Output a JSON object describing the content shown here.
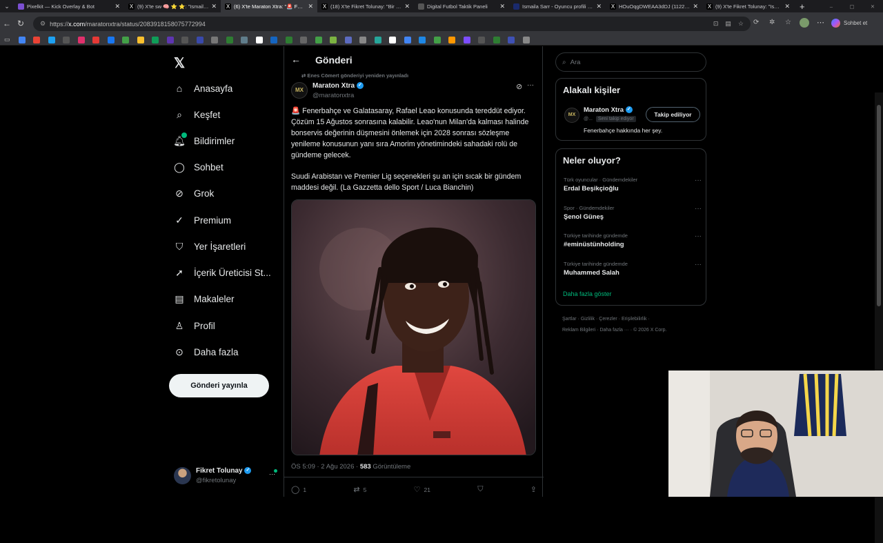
{
  "browser": {
    "tabs": [
      {
        "title": "Pixelkit — Kick Overlay & Bot",
        "color": "#7b4fd1",
        "glyph": "",
        "w": 160
      },
      {
        "title": "(9) X'te sw 🧠 ⭐ ⭐: \"Ismaila Sa",
        "color": "#000000",
        "glyph": "X",
        "w": 140
      },
      {
        "title": "(6) X'te Maraton Xtra: \"🚨 Fene",
        "color": "#000000",
        "glyph": "X",
        "w": 140,
        "active": true
      },
      {
        "title": "(18) X'te Fikret Tolunay: \"Bir sürü",
        "color": "#000000",
        "glyph": "X",
        "w": 140
      },
      {
        "title": "Digital Futbol Taktik Paneli",
        "color": "#555555",
        "glyph": "",
        "w": 138
      },
      {
        "title": "Ismaila Sarr - Oyuncu profili 26/",
        "color": "#1a2a6c",
        "glyph": "",
        "w": 140
      },
      {
        "title": "HOuOqgDWEAA3dDJ (1122×14",
        "color": "#000000",
        "glyph": "X",
        "w": 140
      },
      {
        "title": "(9) X'te Fikret Tolunay: \"Ismaila",
        "color": "#000000",
        "glyph": "X",
        "w": 133
      }
    ],
    "url_prefix": "https://",
    "url_host": "x.com",
    "url_path": "/maratonxtra/status/2083918158075772994",
    "sohbet_label": "Sohbet et",
    "bookmark_colors": [
      "#4285f4",
      "#ea4335",
      "#1da1f2",
      "#555",
      "#e1306c",
      "#e53935",
      "#1877f2",
      "#43a047",
      "#fbc02d",
      "#0f9d58",
      "#5e35b1",
      "#555",
      "#3949ab",
      "#777",
      "#2e7d32",
      "#607d8b",
      "#ffffff",
      "#1565c0",
      "#2e7d32",
      "#666",
      "#43a047",
      "#7cb342",
      "#5c6bc0",
      "#888",
      "#26a69a",
      "#fff",
      "#4285f4",
      "#1e88e5",
      "#43a047",
      "#ff9800",
      "#7c4dff",
      "#555",
      "#2e7d32",
      "#3f51b5",
      "#888"
    ]
  },
  "nav": {
    "items": [
      {
        "label": "Anasayfa",
        "icon": "home-icon"
      },
      {
        "label": "Keşfet",
        "icon": "search-icon"
      },
      {
        "label": "Bildirimler",
        "icon": "bell-icon"
      },
      {
        "label": "Sohbet",
        "icon": "chat-icon"
      },
      {
        "label": "Grok",
        "icon": "grok-icon"
      },
      {
        "label": "Premium",
        "icon": "premium-icon"
      },
      {
        "label": "Yer İşaretleri",
        "icon": "bookmark-icon"
      },
      {
        "label": "İçerik Üreticisi St...",
        "icon": "rocket-icon"
      },
      {
        "label": "Makaleler",
        "icon": "article-icon"
      },
      {
        "label": "Profil",
        "icon": "person-icon"
      },
      {
        "label": "Daha fazla",
        "icon": "more-circle-icon"
      }
    ],
    "post_button": "Gönderi yayınla",
    "account_name": "Fikret Tolunay",
    "account_handle": "@fikretolunay"
  },
  "post": {
    "header_title": "Gönderi",
    "repost_note": "Enes Cömert gönderiyi yeniden yayınladı",
    "author_name": "Maraton Xtra",
    "author_handle": "@maratonxtra",
    "paragraph1": "🚨 Fenerbahçe ve Galatasaray, Rafael Leao konusunda tereddüt ediyor. Çözüm 15 Ağustos sonrasına kalabilir. Leao'nun Milan'da kalması halinde bonservis değerinin düşmesini önlemek için 2028 sonrası sözleşme yenileme konusunun yanı sıra Amorim yönetimindeki sahadaki rolü de gündeme gelecek.",
    "paragraph2": "Suudi Arabistan ve Premier Lig seçenekleri şu an için sıcak bir gündem maddesi değil. (La Gazzetta dello Sport / Luca Bianchin)",
    "time": "ÖS 5:09 · 2 Ağu 2026 · ",
    "views_count": "583",
    "views_label": " Görüntüleme",
    "replies": "1",
    "reposts": "5",
    "likes": "21"
  },
  "sidebar": {
    "search_placeholder": "Ara",
    "related_title": "Alakalı kişiler",
    "related_name": "Maraton Xtra",
    "related_handle": "@...",
    "follows_you": "Seni takip ediyor",
    "follow_button": "Takip ediliyor",
    "related_bio": "Fenerbahçe hakkında her şey.",
    "trends_title": "Neler oluyor?",
    "trends": [
      {
        "context": "Türk oyuncular · Gündemdekiler",
        "title": "Erdal Beşikçioğlu"
      },
      {
        "context": "Spor · Gündemdekiler",
        "title": "Şenol Güneş"
      },
      {
        "context": "Türkiye tarihinde gündemde",
        "title": "#eminüstünholding"
      },
      {
        "context": "Türkiye tarihinde gündemde",
        "title": "Muhammed Salah"
      }
    ],
    "show_more": "Daha fazla göster",
    "footer_line1": "Şartlar  ·  Gizlilik  ·  Çerezler  ·  Erişilebilirlik  ·",
    "footer_line2": "Reklam Bilgileri  ·  Daha fazla ···  ·  © 2026 X Corp."
  },
  "colors": {
    "accent": "#1d9bf0",
    "link_green": "#00ba7c",
    "background": "#000000",
    "border": "#2f3336"
  }
}
